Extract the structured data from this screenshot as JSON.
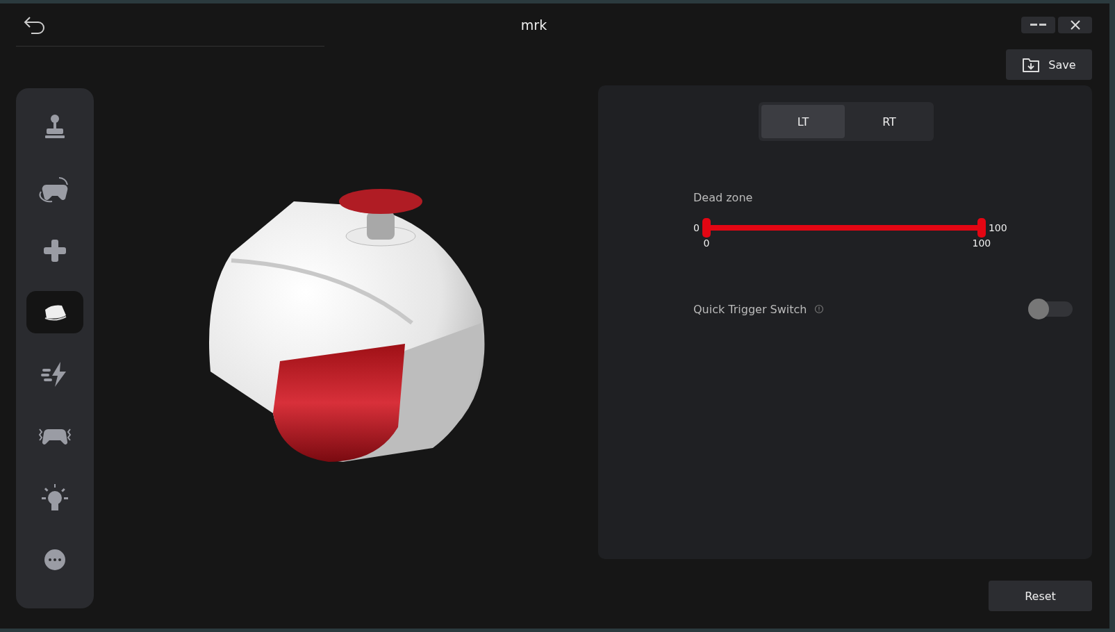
{
  "window": {
    "title": "mrk"
  },
  "save_button": {
    "label": "Save"
  },
  "sidebar": {
    "items": [
      {
        "selected": false
      },
      {
        "selected": false
      },
      {
        "selected": false
      },
      {
        "selected": true
      },
      {
        "selected": false
      },
      {
        "selected": false
      },
      {
        "selected": false
      },
      {
        "selected": false
      }
    ]
  },
  "trigger_tabs": [
    {
      "label": "LT",
      "selected": true
    },
    {
      "label": "RT",
      "selected": false
    }
  ],
  "dead_zone": {
    "label": "Dead zone",
    "min_label": "0",
    "max_label": "100",
    "thumbs": [
      {
        "level": 0,
        "reading": "0"
      },
      {
        "level": 1,
        "reading": "100"
      }
    ]
  },
  "quick_trigger_switch": {
    "label": "Quick Trigger Switch",
    "on": false
  },
  "reset_button": {
    "label": "Reset"
  }
}
